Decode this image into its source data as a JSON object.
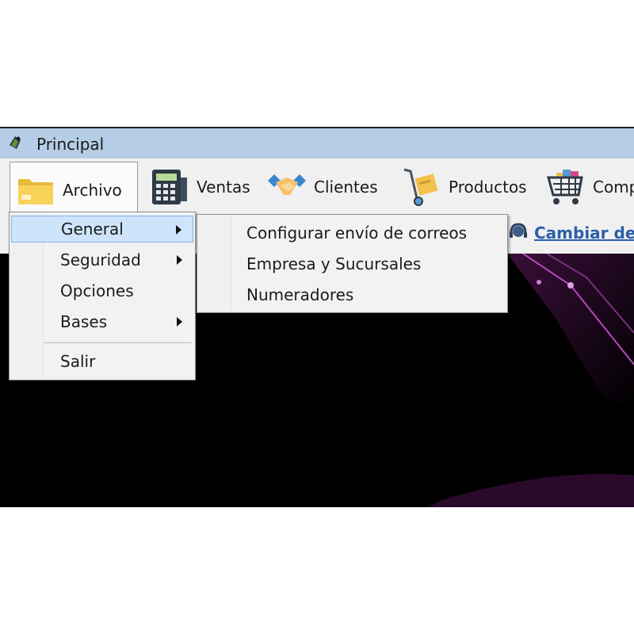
{
  "window": {
    "title": "Principal",
    "title_icon": "app-logo-icon"
  },
  "toolbar": {
    "items": [
      {
        "label": "Archivo",
        "icon": "folder-icon",
        "active": true
      },
      {
        "label": "Ventas",
        "icon": "cash-register-icon"
      },
      {
        "label": "Clientes",
        "icon": "handshake-icon"
      },
      {
        "label": "Productos",
        "icon": "hand-truck-icon"
      },
      {
        "label": "Comp",
        "icon": "shopping-cart-icon"
      }
    ]
  },
  "userbar": {
    "link": "Cambiar de U",
    "icon": "user-headset-icon"
  },
  "menu": {
    "items": [
      {
        "label": "General",
        "has_submenu": true,
        "highlighted": true
      },
      {
        "label": "Seguridad",
        "has_submenu": true
      },
      {
        "label": "Opciones",
        "has_submenu": false
      },
      {
        "label": "Bases",
        "has_submenu": true
      },
      {
        "label": "Salir",
        "has_submenu": false
      }
    ]
  },
  "submenu": {
    "items": [
      {
        "label": "Configurar envío de correos"
      },
      {
        "label": "Empresa y Sucursales"
      },
      {
        "label": "Numeradores"
      }
    ]
  },
  "colors": {
    "highlight": "#cde4fb",
    "titlebar": "#b5cde6",
    "link": "#2b5fa8"
  }
}
